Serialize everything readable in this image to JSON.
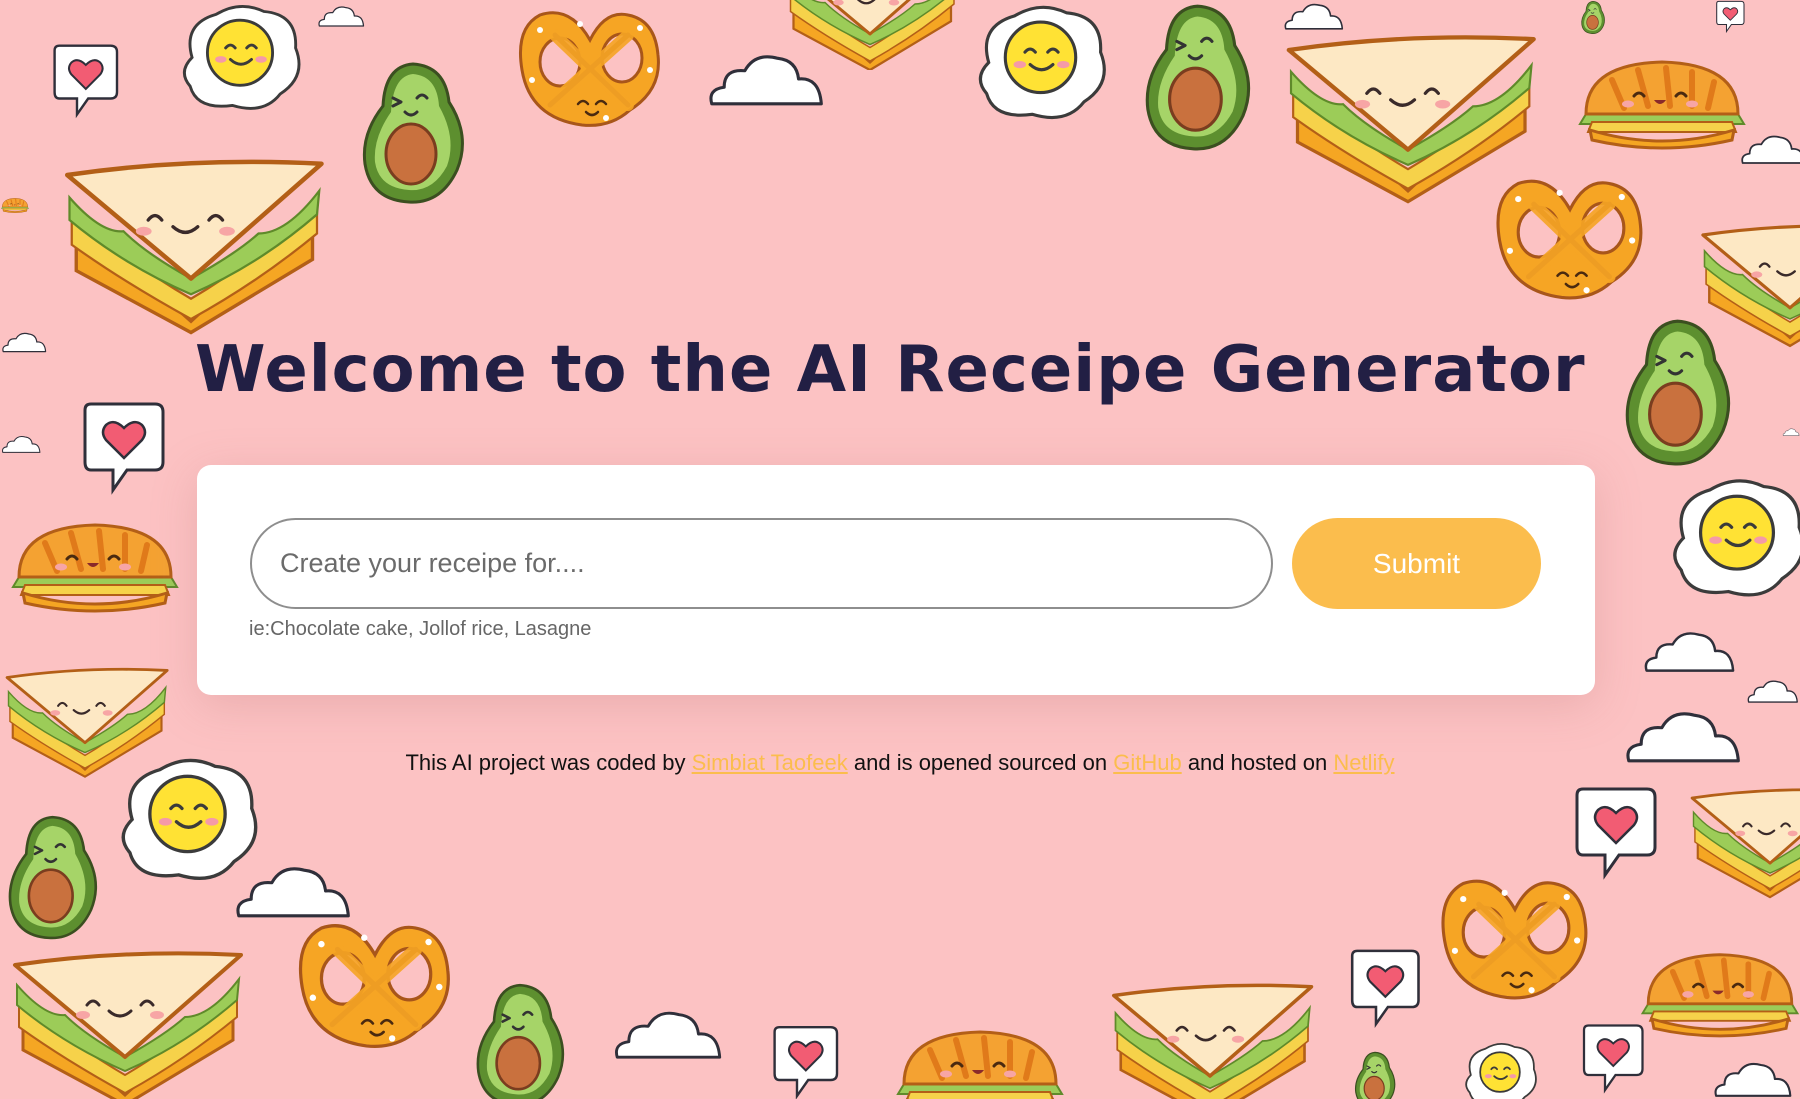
{
  "page": {
    "title": "Welcome to the AI Receipe Generator"
  },
  "form": {
    "input_placeholder": "Create your receipe for....",
    "input_value": "",
    "submit_label": "Submit",
    "hint": "ie:Chocolate cake, Jollof rice, Lasagne"
  },
  "footer": {
    "text_1": "This AI project was coded by",
    "author_link": "Simbiat Taofeek",
    "text_2": "and is opened sourced on",
    "github_link": "GitHub",
    "text_3": "and hosted on",
    "netlify_link": "Netlify"
  },
  "background": {
    "motifs": [
      "sandwich-icon",
      "fried-egg-icon",
      "avocado-icon",
      "pretzel-icon",
      "burger-icon",
      "heart-bubble-icon",
      "cloud-icon"
    ]
  },
  "colors": {
    "background": "#fcc2c3",
    "title": "#221f44",
    "accent": "#fbbd4d",
    "card": "#ffffff"
  }
}
